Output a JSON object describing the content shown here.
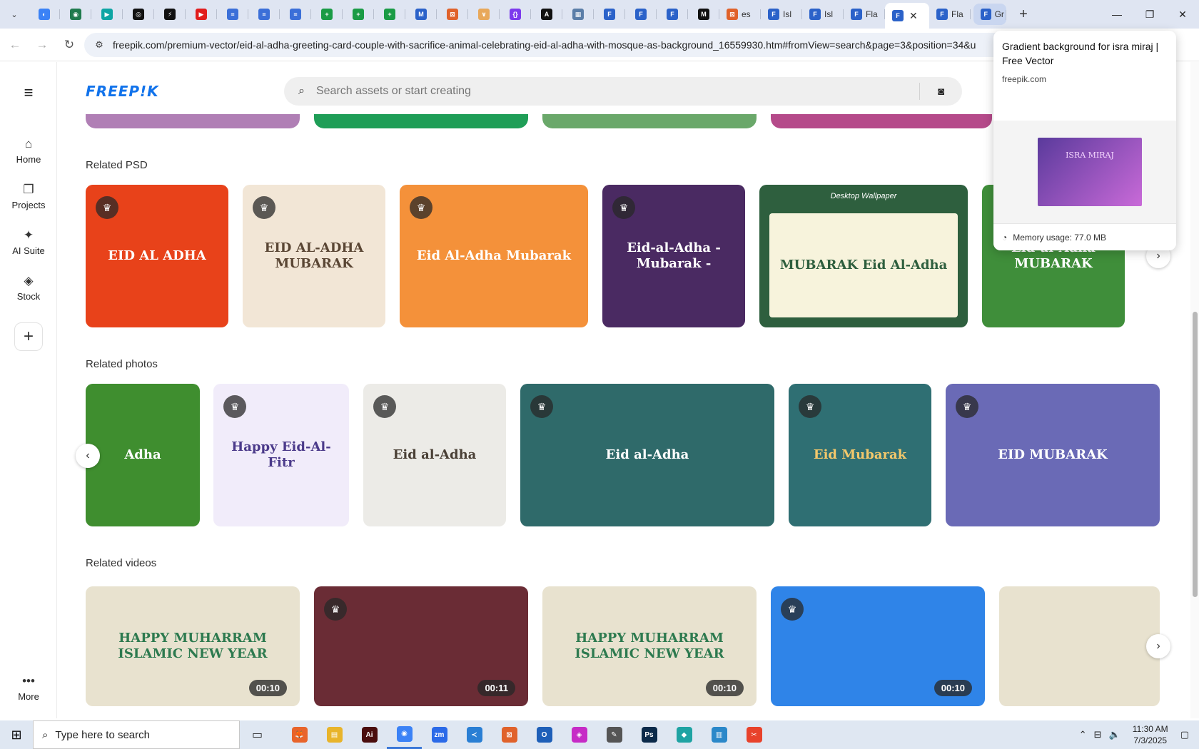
{
  "browser": {
    "tabs": [
      {
        "color": "#3b82f6",
        "glyph": "◐"
      },
      {
        "color": "#1f7a4d",
        "glyph": "◉"
      },
      {
        "color": "#0ea5a4",
        "glyph": "▶"
      },
      {
        "color": "#111111",
        "glyph": "◎"
      },
      {
        "color": "#111111",
        "glyph": "⚡"
      },
      {
        "color": "#e11d1d",
        "glyph": "▶"
      },
      {
        "color": "#3b6fd8",
        "glyph": "≡"
      },
      {
        "color": "#3b6fd8",
        "glyph": "≡"
      },
      {
        "color": "#3b6fd8",
        "glyph": "≡"
      },
      {
        "color": "#1a9b45",
        "glyph": "+"
      },
      {
        "color": "#1a9b45",
        "glyph": "+"
      },
      {
        "color": "#1a9b45",
        "glyph": "+"
      },
      {
        "color": "#2b62c9",
        "glyph": "M"
      },
      {
        "color": "#e0622b",
        "glyph": "⊠"
      },
      {
        "color": "#e8a85a",
        "glyph": "∨"
      },
      {
        "color": "#7c3aed",
        "glyph": "{}"
      },
      {
        "color": "#111111",
        "glyph": "A"
      },
      {
        "color": "#5b7ea8",
        "glyph": "▦"
      },
      {
        "color": "#2b62c9",
        "glyph": "F"
      },
      {
        "color": "#2b62c9",
        "glyph": "F"
      },
      {
        "color": "#2b62c9",
        "glyph": "F"
      },
      {
        "color": "#111111",
        "glyph": "M"
      }
    ],
    "titled_tabs": [
      {
        "title": "es",
        "color": "#e0622b",
        "glyph": "⊠"
      },
      {
        "title": "Isl",
        "color": "#2b62c9",
        "glyph": "F"
      },
      {
        "title": "Isl",
        "color": "#2b62c9",
        "glyph": "F"
      },
      {
        "title": "Fla",
        "color": "#2b62c9",
        "glyph": "F"
      }
    ],
    "active_tab": {
      "color": "#2b62c9",
      "glyph": "F"
    },
    "after_tabs": [
      {
        "title": "Fla",
        "color": "#2b62c9",
        "glyph": "F"
      },
      {
        "title": "Gr",
        "color": "#2b62c9",
        "glyph": "F"
      }
    ],
    "url": "freepik.com/premium-vector/eid-al-adha-greeting-card-couple-with-sacrifice-animal-celebrating-eid-al-adha-with-mosque-as-background_16559930.htm#fromView=search&page=3&position=34&u"
  },
  "hovercard": {
    "title": "Gradient background for isra miraj | Free Vector",
    "domain": "freepik.com",
    "thumb_text": "ISRA MIRAJ",
    "memory": "Memory usage: 77.0 MB"
  },
  "sidebar": {
    "items": [
      {
        "label": "Home",
        "icon": "⌂"
      },
      {
        "label": "Projects",
        "icon": "❐"
      },
      {
        "label": "AI Suite",
        "icon": "✦"
      },
      {
        "label": "Stock",
        "icon": "◈"
      }
    ],
    "more": "More"
  },
  "header": {
    "logo": "FREEP!K",
    "search_placeholder": "Search assets or start creating"
  },
  "sections": {
    "psd_title": "Related PSD",
    "photos_title": "Related photos",
    "videos_title": "Related videos"
  },
  "psd_cards": [
    {
      "text": "EID AL ADHA",
      "bg": "#e8421a",
      "fg": "#ffffff",
      "premium": true
    },
    {
      "text": "EID AL-ADHA MUBARAK",
      "bg": "#f2e6d6",
      "fg": "#5a4634",
      "premium": true
    },
    {
      "text": "Eid Al-Adha Mubarak",
      "bg": "#f4913a",
      "fg": "#ffffff",
      "premium": true
    },
    {
      "text": "Eid-al-Adha - Mubarak -",
      "bg": "#4a2a62",
      "fg": "#ffffff",
      "premium": true
    },
    {
      "text": "MUBARAK Eid Al-Adha",
      "bg": "#2e5f3e",
      "fg": "#2e5f3e",
      "premium": false,
      "header": "Desktop Wallpaper"
    },
    {
      "text": "Eid-al-Adha MUBARAK",
      "bg": "#3f8e3a",
      "fg": "#ffffff",
      "premium": false
    }
  ],
  "photo_cards": [
    {
      "text": "Adha",
      "bg": "#3f8e2f",
      "fg": "#ffffff",
      "premium": false
    },
    {
      "text": "Happy Eid-Al-Fitr",
      "bg": "#f1ecfa",
      "fg": "#4b3a8a",
      "premium": true
    },
    {
      "text": "Eid al-Adha",
      "bg": "#ecebe7",
      "fg": "#4a4036",
      "premium": true
    },
    {
      "text": "Eid al-Adha",
      "bg": "#2f6a6a",
      "fg": "#ffffff",
      "premium": true
    },
    {
      "text": "Eid Mubarak",
      "bg": "#2f6f73",
      "fg": "#f3c86b",
      "premium": true
    },
    {
      "text": "EID MUBARAK",
      "bg": "#6a6ab6",
      "fg": "#ffffff",
      "premium": true
    }
  ],
  "video_cards": [
    {
      "text": "HAPPY MUHARRAM ISLAMIC NEW YEAR",
      "bg": "#e8e2cf",
      "fg": "#2d7a4f",
      "duration": "00:10",
      "premium": false
    },
    {
      "text": "",
      "bg": "#6a2c35",
      "fg": "#ffffff",
      "duration": "00:11",
      "premium": true
    },
    {
      "text": "HAPPY MUHARRAM ISLAMIC NEW YEAR",
      "bg": "#e8e2cf",
      "fg": "#2d7a4f",
      "duration": "00:10",
      "premium": false
    },
    {
      "text": "",
      "bg": "#2f84e8",
      "fg": "#ffffff",
      "duration": "00:10",
      "premium": true
    },
    {
      "text": "",
      "bg": "#e8e2cf",
      "fg": "#2d7a4f",
      "duration": "",
      "premium": false
    }
  ],
  "taskbar": {
    "search_placeholder": "Type here to search",
    "apps": [
      {
        "color": "#e8642b",
        "glyph": "🦊"
      },
      {
        "color": "#e8b42b",
        "glyph": "▤"
      },
      {
        "color": "#4a0d0d",
        "glyph": "Ai"
      },
      {
        "color": "#3b82f6",
        "glyph": "◉"
      },
      {
        "color": "#2b6ae8",
        "glyph": "zm"
      },
      {
        "color": "#2a7fd4",
        "glyph": "≺"
      },
      {
        "color": "#e0622b",
        "glyph": "⊠"
      },
      {
        "color": "#1e5fb8",
        "glyph": "O"
      },
      {
        "color": "#c62bc6",
        "glyph": "◈"
      },
      {
        "color": "#555555",
        "glyph": "✎"
      },
      {
        "color": "#0b2a4a",
        "glyph": "Ps"
      },
      {
        "color": "#1fa3a3",
        "glyph": "◆"
      },
      {
        "color": "#2b88c9",
        "glyph": "▥"
      },
      {
        "color": "#e8422b",
        "glyph": "✂"
      }
    ],
    "time": "11:30 AM",
    "date": "7/3/2025"
  }
}
